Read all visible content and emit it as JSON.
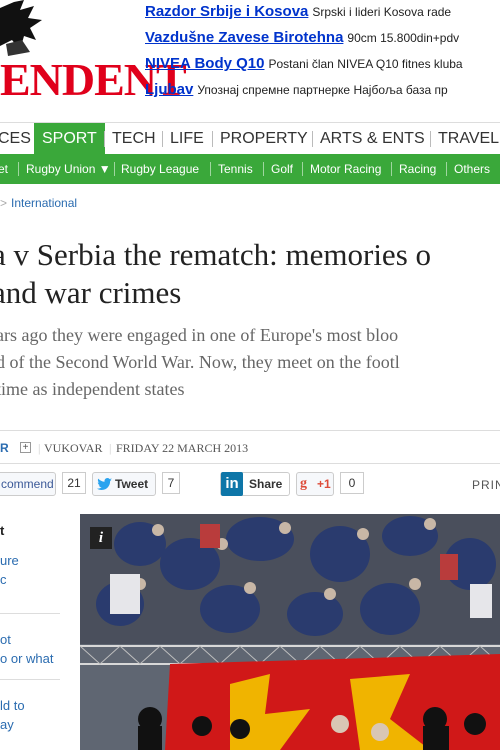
{
  "masthead": {
    "logo": "ENDENT"
  },
  "ads": [
    {
      "title": "Razdor Srbije i Kosova",
      "desc": "Srpski i lideri Kosova rade"
    },
    {
      "title": "Vazdušne Zavese Birotehna",
      "desc": "90cm 15.800din+pdv"
    },
    {
      "title": "NIVEA Body Q10",
      "desc": "Postani član NIVEA Q10 fitnes kluba"
    },
    {
      "title": "Ljubav",
      "desc": "Упознај спремне партнерке Најбоља база пр"
    }
  ],
  "mainnav": [
    "CES",
    "SPORT",
    "TECH",
    "LIFE",
    "PROPERTY",
    "ARTS & ENTS",
    "TRAVEL"
  ],
  "subnav": [
    "et",
    "Rugby Union",
    "Rugby League",
    "Tennis",
    "Golf",
    "Motor Racing",
    "Racing",
    "Others"
  ],
  "breadcrumb": {
    "arrow": ">",
    "label": "International"
  },
  "article": {
    "headline_1": "a v Serbia the rematch: memories o",
    "headline_2": "and war crimes",
    "standfirst_1": "ars ago they were engaged in one of Europe's most bloo",
    "standfirst_2": "d of the Second World War. Now, they meet on the footl",
    "standfirst_3": "time as independent states"
  },
  "byline": {
    "author": "R",
    "plus": "+",
    "location": "VUKOVAR",
    "date": "FRIDAY 22 MARCH 2013"
  },
  "social": {
    "recommend_label": "commend",
    "recommend_count": "21",
    "tweet_label": "Tweet",
    "tweet_count": "7",
    "share_label": "Share",
    "gplus_label": "+1",
    "gplus_count": "0",
    "print_label": "PRIN"
  },
  "sidebar": {
    "heading": "t",
    "item1": [
      "ure",
      "c"
    ],
    "item2": [
      "ot",
      "o or what"
    ],
    "item3": [
      "ld to",
      "ay"
    ]
  },
  "photo": {
    "info_label": "i"
  },
  "colors": {
    "brand_red": "#e0001b",
    "sport_green": "#3aa83a",
    "link_blue": "#2b6cb0"
  }
}
